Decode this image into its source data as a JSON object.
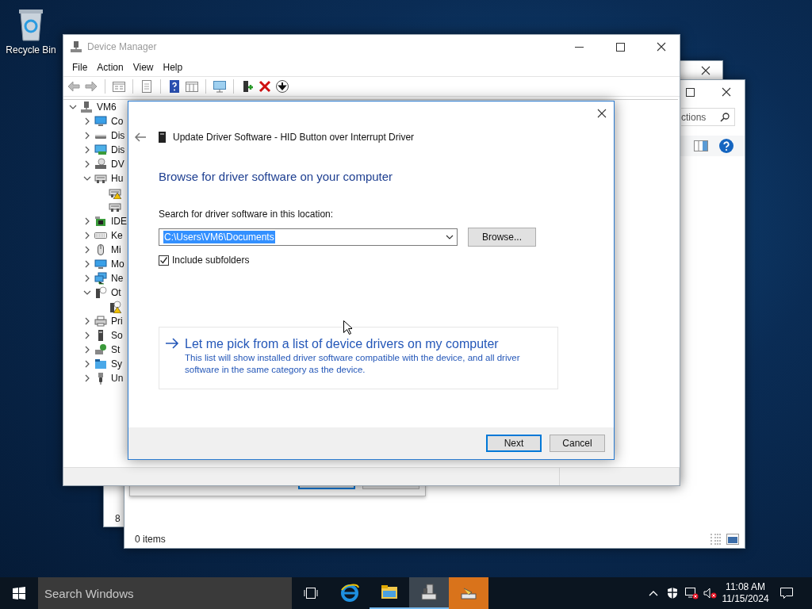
{
  "desktop_icons": [
    {
      "label": "Recycle Bin"
    }
  ],
  "back_window_1": {
    "status_text": "8"
  },
  "back_window_2": {
    "search": {
      "placeholder": "ctions"
    },
    "status_text": "0 items"
  },
  "device_manager": {
    "title": "Device Manager",
    "menu": [
      "File",
      "Action",
      "View",
      "Help"
    ],
    "tree": {
      "label": "VM6",
      "expanded": true,
      "children": [
        {
          "label": "Co",
          "expanded": false
        },
        {
          "label": "Dis",
          "expanded": false
        },
        {
          "label": "Dis",
          "expanded": false
        },
        {
          "label": "DV",
          "expanded": false
        },
        {
          "label": "Hu",
          "expanded": true,
          "children": [
            {
              "warning": true
            },
            {
              "warning": false
            }
          ]
        },
        {
          "label": "IDE",
          "expanded": false
        },
        {
          "label": "Ke",
          "expanded": false
        },
        {
          "label": "Mi",
          "expanded": false
        },
        {
          "label": "Mo",
          "expanded": false
        },
        {
          "label": "Ne",
          "expanded": false
        },
        {
          "label": "Ot",
          "expanded": true,
          "children": [
            {
              "warning": true
            }
          ]
        },
        {
          "label": "Pri",
          "expanded": false
        },
        {
          "label": "So",
          "expanded": false
        },
        {
          "label": "St",
          "expanded": false
        },
        {
          "label": "Sy",
          "expanded": false
        },
        {
          "label": "Un",
          "expanded": false
        }
      ]
    }
  },
  "dialog": {
    "title": "Update Driver Software - HID Button over Interrupt Driver",
    "heading": "Browse for driver software on your computer",
    "location_label": "Search for driver software in this location:",
    "location": {
      "value": "C:\\Users\\VM6\\Documents",
      "selected": true
    },
    "browse_button": "Browse...",
    "include_subfolders": {
      "label": "Include subfolders",
      "checked": true
    },
    "pick_option": {
      "title": "Let me pick from a list of device drivers on my computer",
      "description": "This list will show installed driver software compatible with the device, and all driver software in the same category as the device."
    },
    "buttons": [
      {
        "label": "Next",
        "default": true
      },
      {
        "label": "Cancel",
        "default": false
      }
    ]
  },
  "taskbar": {
    "search": {
      "placeholder": "Search Windows"
    },
    "apps": [
      {
        "kind": "browser",
        "running": false,
        "selected": false,
        "attention": false
      },
      {
        "kind": "folder",
        "running": true,
        "selected": false,
        "attention": false
      },
      {
        "kind": "device-manager",
        "running": true,
        "selected": true,
        "attention": false
      },
      {
        "kind": "installer",
        "running": false,
        "selected": false,
        "attention": true
      }
    ],
    "time": "11:08 AM",
    "date": "11/15/2024"
  }
}
